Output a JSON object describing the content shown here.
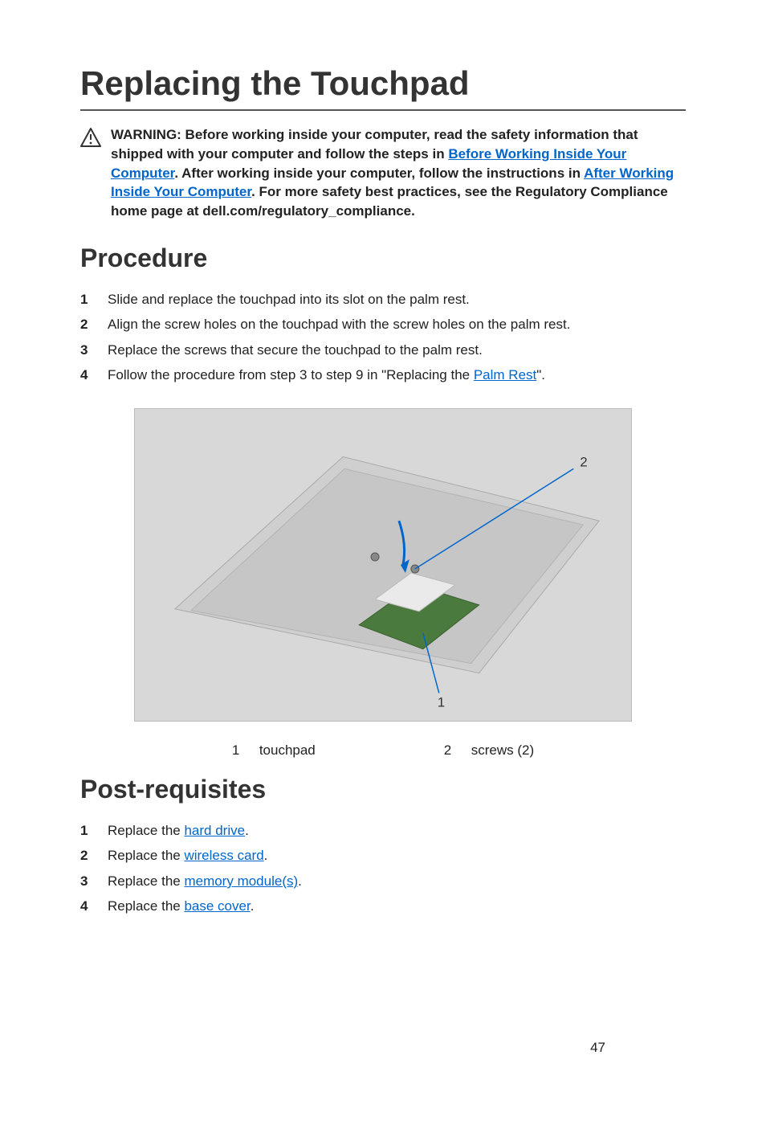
{
  "page_title": "Replacing the Touchpad",
  "warning": {
    "prefix": "WARNING: Before working inside your computer, read the safety information that shipped with your computer and follow the steps in ",
    "link1_text": "Before Working Inside Your Computer",
    "middle1": ". After working inside your computer, follow the instructions in ",
    "link2_text": "After Working Inside Your Computer",
    "suffix": ". For more safety best practices, see the Regulatory Compliance home page at dell.com/regulatory_compliance."
  },
  "procedure": {
    "title": "Procedure",
    "steps": [
      {
        "num": "1",
        "text": "Slide and replace the touchpad into its slot on the palm rest."
      },
      {
        "num": "2",
        "text": "Align the screw holes on the touchpad with the screw holes on the palm rest."
      },
      {
        "num": "3",
        "text": "Replace the screws that secure the touchpad to the palm rest."
      },
      {
        "num": "4",
        "text_before": "Follow the procedure from step 3 to step 9 in \"Replacing the ",
        "link_text": "Palm Rest",
        "text_after": "\"."
      }
    ]
  },
  "figure": {
    "alt": "Palm rest assembly showing touchpad and screws",
    "callouts": {
      "touchpad": "1",
      "screws": "2"
    },
    "legend": [
      {
        "num": "1",
        "label": "touchpad"
      },
      {
        "num": "2",
        "label": "screws (2)"
      }
    ]
  },
  "postreq": {
    "title": "Post-requisites",
    "steps": [
      {
        "num": "1",
        "text_before": "Replace the ",
        "link_text": "hard drive",
        "text_after": "."
      },
      {
        "num": "2",
        "text_before": "Replace the ",
        "link_text": "wireless card",
        "text_after": "."
      },
      {
        "num": "3",
        "text_before": "Replace the ",
        "link_text": "memory module(s)",
        "text_after": "."
      },
      {
        "num": "4",
        "text_before": "Replace the ",
        "link_text": "base cover",
        "text_after": "."
      }
    ]
  },
  "page_number": "47"
}
